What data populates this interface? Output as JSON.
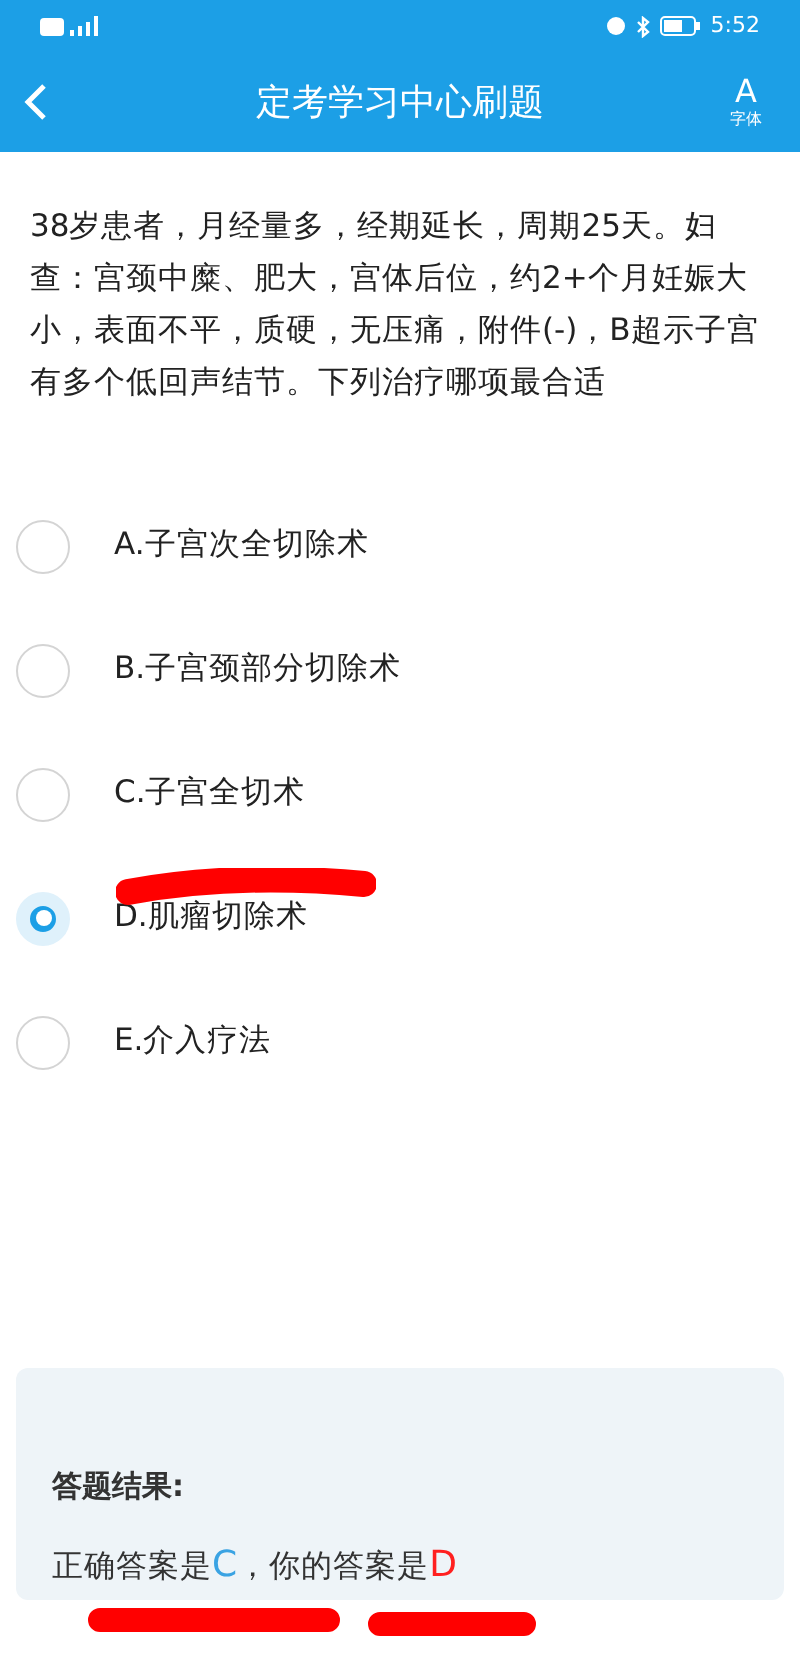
{
  "status_bar": {
    "time": "5:52"
  },
  "header": {
    "title": "定考学习中心刷题",
    "font_button": {
      "glyph": "A",
      "label": "字体"
    }
  },
  "question": {
    "text": "38岁患者，月经量多，经期延长，周期25天。妇查：宫颈中糜、肥大，宫体后位，约2+个月妊娠大小，表面不平，质硬，无压痛，附件(-)，B超示子宫有多个低回声结节。下列治疗哪项最合适"
  },
  "options": [
    {
      "label": "A.子宫次全切除术",
      "selected": false
    },
    {
      "label": "B.子宫颈部分切除术",
      "selected": false
    },
    {
      "label": "C.子宫全切术",
      "selected": false
    },
    {
      "label": "D.肌瘤切除术",
      "selected": true
    },
    {
      "label": "E.介入疗法",
      "selected": false
    }
  ],
  "result": {
    "title": "答题结果:",
    "prefix": "正确答案是",
    "correct": "C",
    "middle": "，你的答案是",
    "yours": "D"
  }
}
